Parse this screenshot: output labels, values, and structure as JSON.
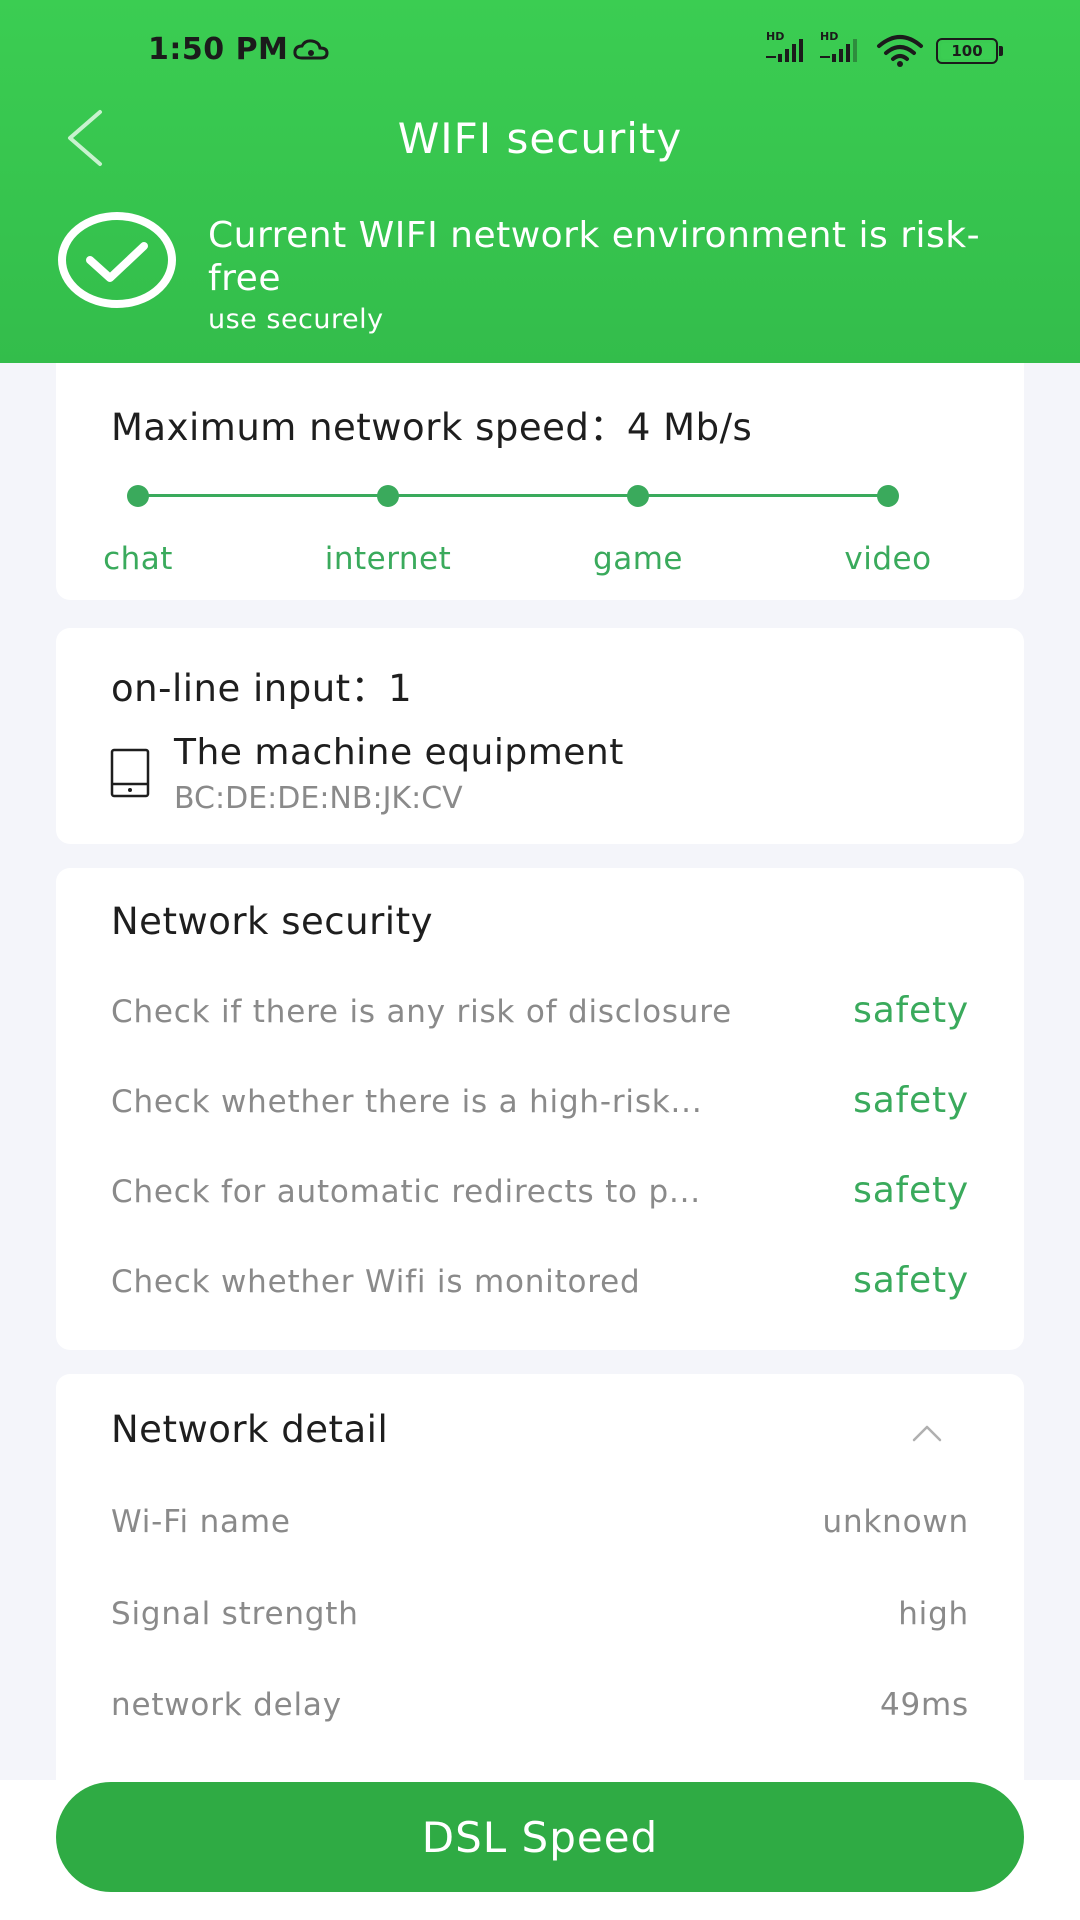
{
  "status_bar": {
    "time": "1:50 PM",
    "signal_hd_1": "HD",
    "signal_hd_2": "HD",
    "battery": "100"
  },
  "header": {
    "title": "WIFI security",
    "status_title": "Current WIFI network environment is risk-free",
    "status_subtitle": "use securely"
  },
  "speed_card": {
    "title": "Maximum network speed：4 Mb/s",
    "levels": [
      "chat",
      "internet",
      "game",
      "video"
    ]
  },
  "online_card": {
    "title": "on-line input：1",
    "device_name": "The machine equipment",
    "device_mac": "BC:DE:DE:NB:JK:CV"
  },
  "security_card": {
    "title": "Network security",
    "checks": [
      {
        "label": "Check if there is any risk of disclosure",
        "status": "safety"
      },
      {
        "label": "Check whether there is a high-risk...",
        "status": "safety"
      },
      {
        "label": "Check for automatic redirects to p...",
        "status": "safety"
      },
      {
        "label": "Check whether Wifi is monitored",
        "status": "safety"
      }
    ]
  },
  "detail_card": {
    "title": "Network detail",
    "rows": [
      {
        "label": "Wi-Fi name",
        "value": "unknown"
      },
      {
        "label": "Signal strength",
        "value": "high"
      },
      {
        "label": "network delay",
        "value": "49ms"
      }
    ]
  },
  "action": {
    "button_label": "DSL Speed"
  },
  "colors": {
    "header_green": "#3bcd52",
    "accent_green": "#3aaa5c",
    "button_green": "#2fab44"
  }
}
